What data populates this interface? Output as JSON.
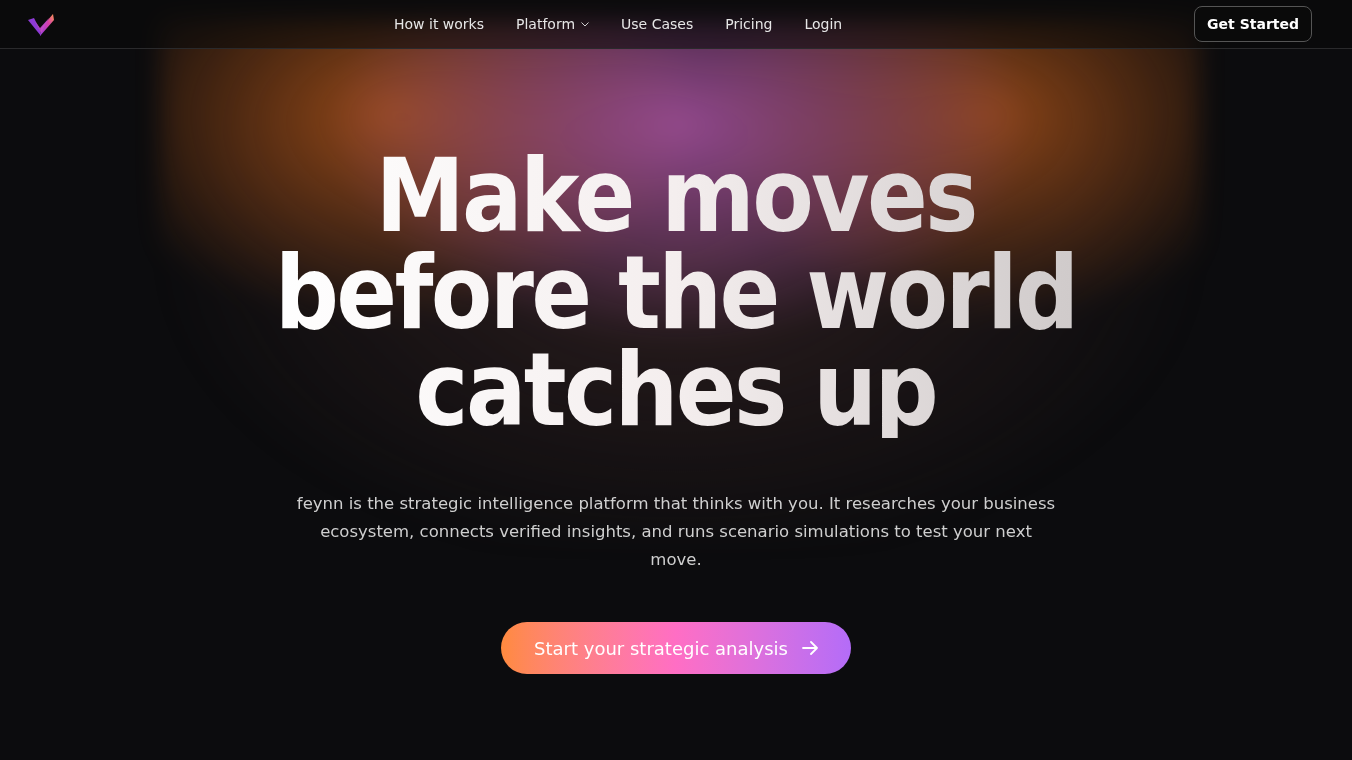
{
  "nav": {
    "links": [
      {
        "label": "How it works",
        "kind": "link"
      },
      {
        "label": "Platform",
        "kind": "dropdown"
      },
      {
        "label": "Use Cases",
        "kind": "link"
      },
      {
        "label": "Pricing",
        "kind": "link"
      },
      {
        "label": "Login",
        "kind": "link"
      }
    ],
    "cta": "Get Started"
  },
  "hero": {
    "headline_lines": [
      "Make moves",
      "before the world",
      "catches up"
    ],
    "description": "feynn is the strategic intelligence platform that thinks with you. It researches your business ecosystem, connects verified insights, and runs scenario simulations to test your next move.",
    "button": "Start your strategic analysis"
  }
}
